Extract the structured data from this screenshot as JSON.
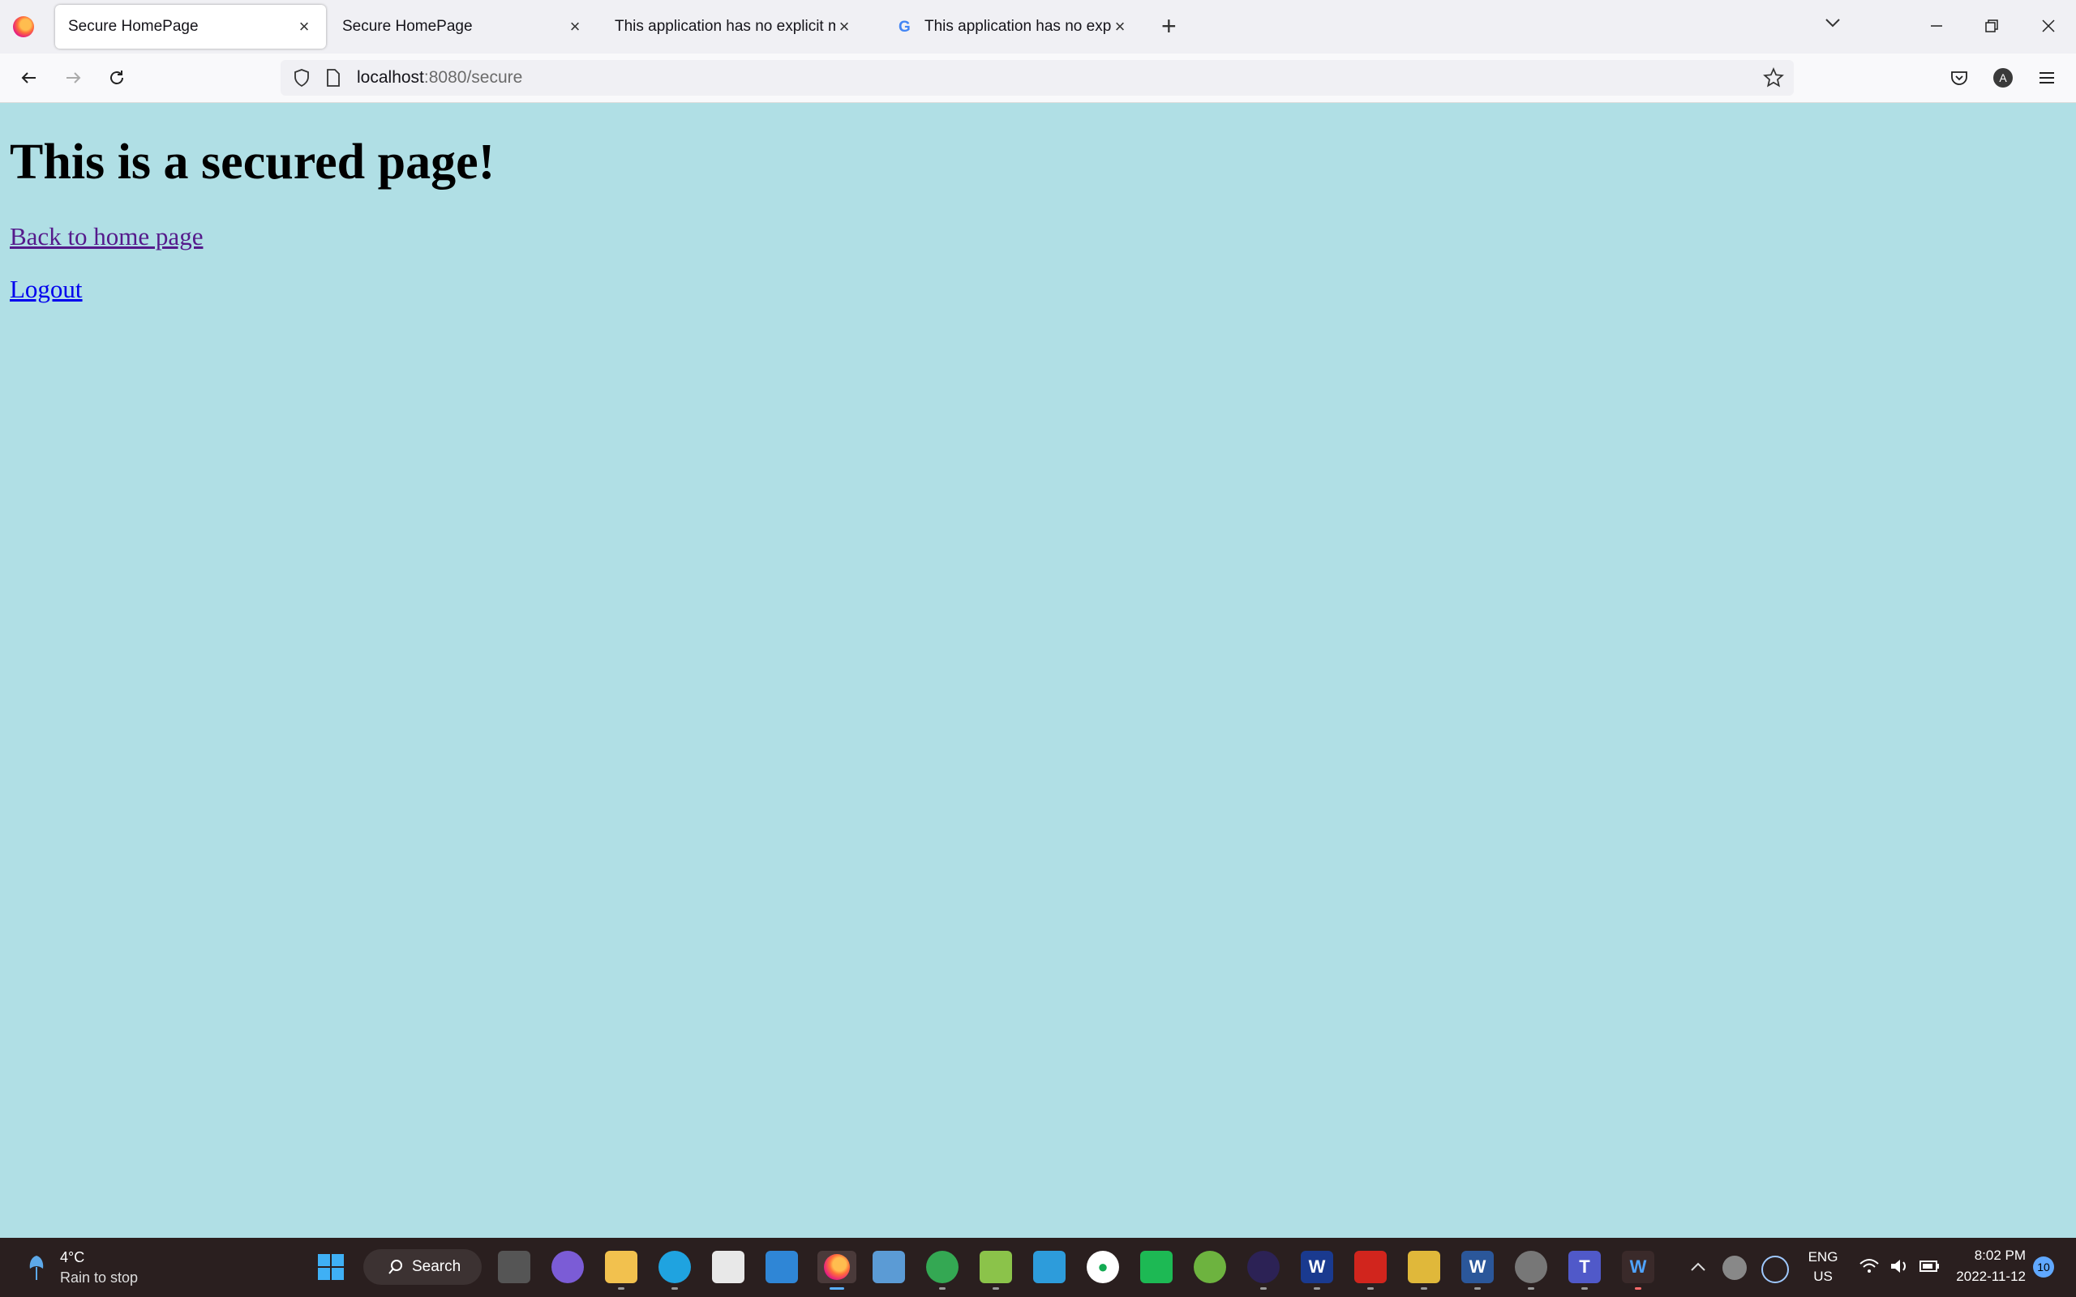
{
  "browser": {
    "tabs": [
      {
        "label": "Secure HomePage",
        "active": true
      },
      {
        "label": "Secure HomePage",
        "active": false
      },
      {
        "label": "This application has no explicit map",
        "active": false
      },
      {
        "label": "This application has no explicit",
        "active": false,
        "icon": "google-icon"
      }
    ],
    "url_host": "localhost",
    "url_rest": ":8080/secure"
  },
  "page": {
    "heading": "This is a secured page!",
    "link_home": "Back to home page",
    "link_logout": "Logout"
  },
  "taskbar": {
    "weather_temp": "4°C",
    "weather_desc": "Rain to stop",
    "search_label": "Search",
    "lang_1": "ENG",
    "lang_2": "US",
    "time": "8:02 PM",
    "date": "2022-11-12",
    "notification_count": "10"
  },
  "colors": {
    "page_background": "#b0dfe5",
    "taskbar": "#2a1f1f"
  }
}
